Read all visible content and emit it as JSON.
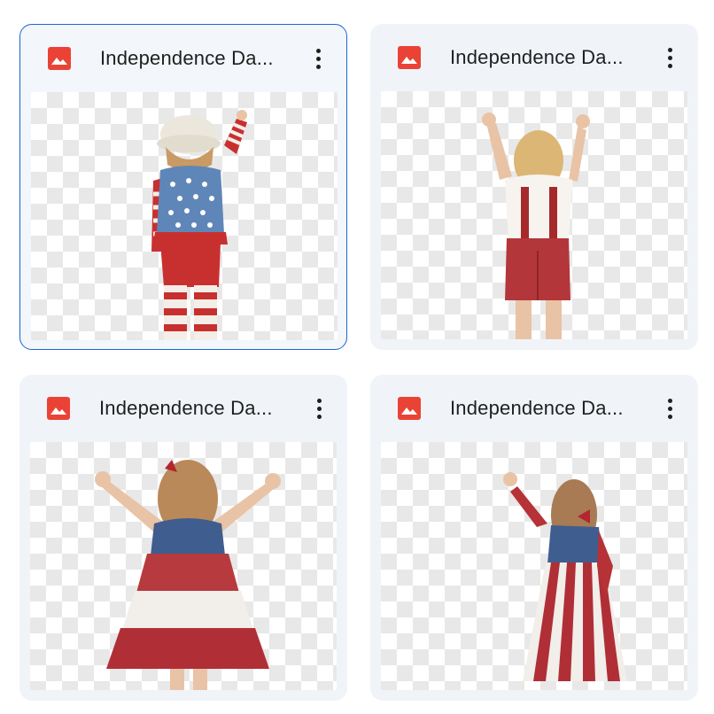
{
  "files": [
    {
      "title": "Independence Da...",
      "type_icon": "image-file-icon",
      "selected": true,
      "image_desc": "child in star vest and striped pants pointing up"
    },
    {
      "title": "Independence Da...",
      "type_icon": "image-file-icon",
      "selected": false,
      "image_desc": "child in white shirt and red shorts with arms raised"
    },
    {
      "title": "Independence Da...",
      "type_icon": "image-file-icon",
      "selected": false,
      "image_desc": "child in tiered flag dress with arms spread"
    },
    {
      "title": "Independence Da...",
      "type_icon": "image-file-icon",
      "selected": false,
      "image_desc": "child in long striped flag dress waving"
    }
  ],
  "colors": {
    "card_bg": "#f0f4f9",
    "selected_border": "#1a66d2",
    "image_icon_red": "#ea4335",
    "title_text": "#1f1f1f"
  }
}
